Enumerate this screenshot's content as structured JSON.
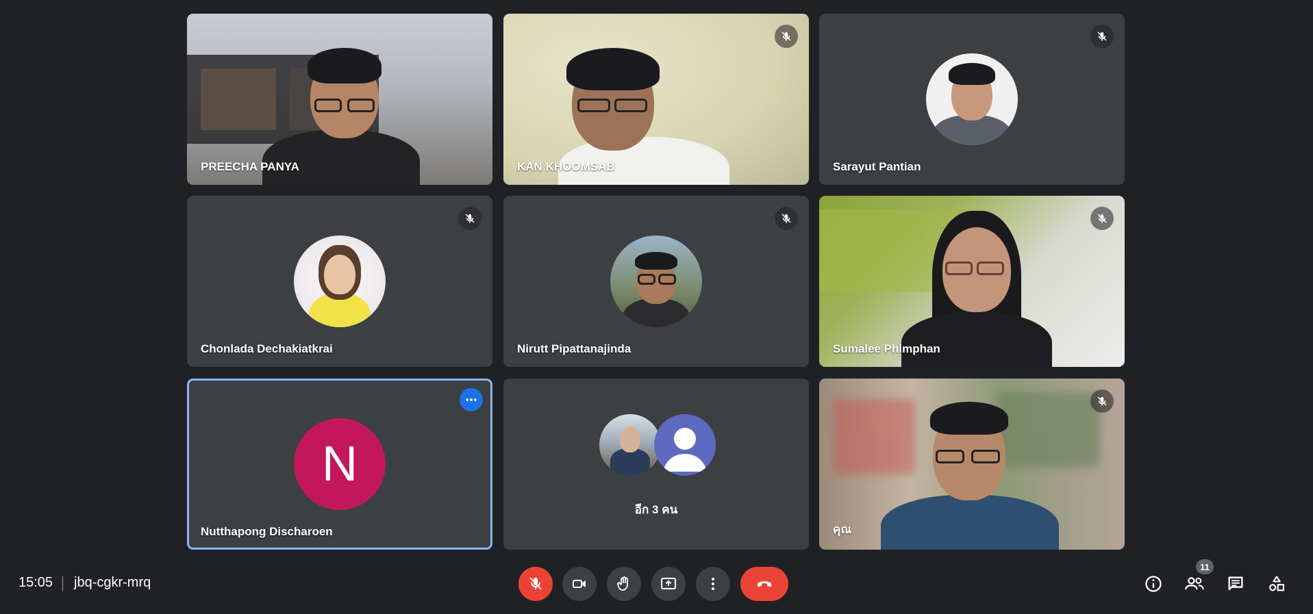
{
  "tiles": [
    {
      "name": "PREECHA PANYA",
      "muted": false
    },
    {
      "name": "KAN KHOOMSAB",
      "muted": true
    },
    {
      "name": "Sarayut Pantian",
      "muted": true
    },
    {
      "name": "Chonlada Dechakiatkrai",
      "muted": true
    },
    {
      "name": "Nirutt Pipattanajinda",
      "muted": true
    },
    {
      "name": "Sumalee Phimphan",
      "muted": true
    },
    {
      "name": "Nutthapong Discharoen",
      "muted": false,
      "avatar_letter": "N",
      "active": true
    },
    {
      "name": "อีก 3 คน",
      "muted": false
    },
    {
      "name": "คุณ",
      "muted": true
    }
  ],
  "meeting": {
    "time": "15:05",
    "code": "jbq-cgkr-mrq"
  },
  "controls": {
    "participant_count": "11"
  },
  "icons": [
    "mic-off-icon",
    "videocam-icon",
    "hand-raise-icon",
    "present-screen-icon",
    "more-vert-icon",
    "call-end-icon",
    "info-icon",
    "people-icon",
    "chat-icon",
    "activities-icon"
  ],
  "colors": {
    "background": "#202124",
    "tile": "#3c4043",
    "danger": "#ea4335",
    "active_outline": "#8ab4f8",
    "more_button": "#1a73e8",
    "avatar_n": "#c2185b"
  }
}
